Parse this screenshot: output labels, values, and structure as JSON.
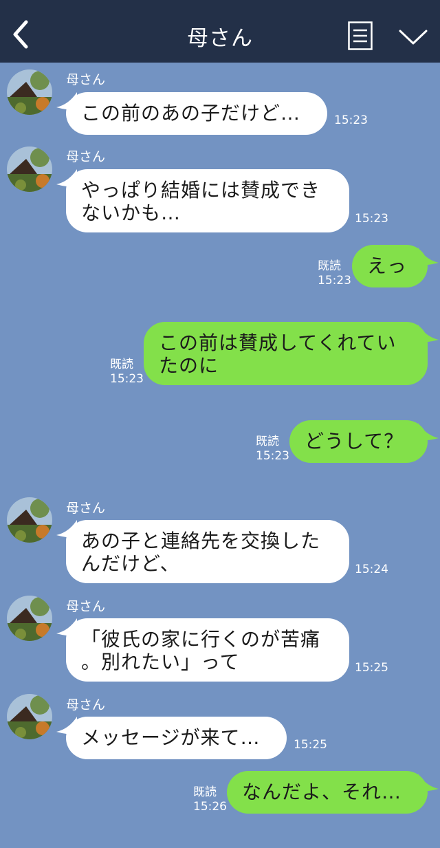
{
  "header": {
    "title": "母さん"
  },
  "messages": [
    {
      "side": "in",
      "sender": "母さん",
      "lines": [
        "この前のあの子だけど…"
      ],
      "time": "15:23"
    },
    {
      "side": "in",
      "sender": "母さん",
      "lines": [
        "やっぱり結婚には賛成でき",
        "ないかも…"
      ],
      "time": "15:23"
    },
    {
      "side": "out",
      "read": "既読",
      "lines": [
        "えっ"
      ],
      "time": "15:23"
    },
    {
      "side": "out",
      "read": "既読",
      "lines": [
        "この前は賛成してくれてい",
        "たのに"
      ],
      "time": "15:23"
    },
    {
      "side": "out",
      "read": "既読",
      "lines": [
        "どうして？"
      ],
      "time": "15:23"
    },
    {
      "side": "in",
      "sender": "母さん",
      "lines": [
        "あの子と連絡先を交換した",
        "んだけど、"
      ],
      "time": "15:24"
    },
    {
      "side": "in",
      "sender": "母さん",
      "lines": [
        "「彼氏の家に行くのが苦痛",
        "。別れたい」って"
      ],
      "time": "15:25"
    },
    {
      "side": "in",
      "sender": "母さん",
      "lines": [
        "メッセージが来て…"
      ],
      "time": "15:25"
    },
    {
      "side": "out",
      "read": "既読",
      "lines": [
        "なんだよ、それ…"
      ],
      "time": "15:26"
    }
  ],
  "colors": {
    "background": "#7393c2",
    "header": "#233048",
    "incoming_bubble": "#ffffff",
    "outgoing_bubble": "#83e04a"
  },
  "icons": {
    "back": "back-chevron-icon",
    "menu": "menu-list-icon",
    "expand": "chevron-down-icon"
  }
}
